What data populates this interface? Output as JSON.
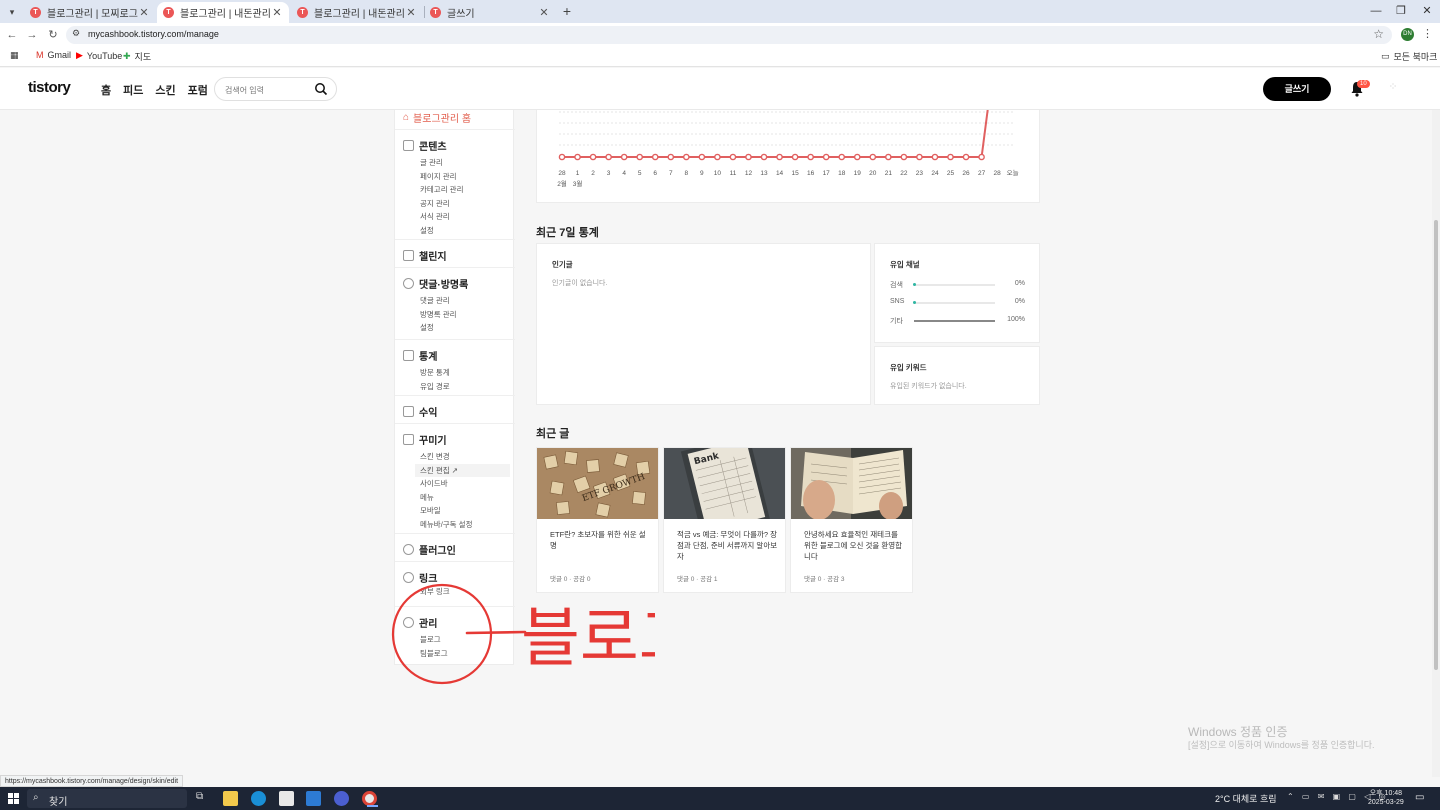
{
  "browser": {
    "tabs": [
      {
        "title": "블로그관리 | 모찌로그",
        "active": false
      },
      {
        "title": "블로그관리 | 내돈관리일지",
        "active": true
      },
      {
        "title": "블로그관리 | 내돈관리일지",
        "active": false
      },
      {
        "title": "글쓰기",
        "active": false
      }
    ],
    "url": "mycashbook.tistory.com/manage",
    "bookmarks": [
      "Gmail",
      "YouTube",
      "지도"
    ],
    "bookmarks_all": "모든 북마크",
    "profile_initials": "DN",
    "status_url": "https://mycashbook.tistory.com/manage/design/skin/edit"
  },
  "header": {
    "logo": "tistory",
    "nav": [
      "홈",
      "피드",
      "스킨",
      "포럼"
    ],
    "search_placeholder": "검색어 입력",
    "write_button": "글쓰기",
    "notification_count": "10"
  },
  "sidebar": {
    "home": "블로그관리 홈",
    "groups": [
      {
        "title": "콘텐츠",
        "items": [
          "글 관리",
          "페이지 관리",
          "카테고리 관리",
          "공지 관리",
          "서식 관리",
          "설정"
        ]
      },
      {
        "title": "챌린지",
        "items": []
      },
      {
        "title": "댓글·방명록",
        "items": [
          "댓글 관리",
          "방명록 관리",
          "설정"
        ]
      },
      {
        "title": "통계",
        "items": [
          "방문 통계",
          "유입 경로"
        ]
      },
      {
        "title": "수익",
        "items": []
      },
      {
        "title": "꾸미기",
        "items": [
          "스킨 변경",
          "스킨 편집",
          "사이드바",
          "메뉴",
          "모바일",
          "메뉴바/구독 설정"
        ]
      },
      {
        "title": "플러그인",
        "items": []
      },
      {
        "title": "링크",
        "items": [
          "외부 링크"
        ]
      },
      {
        "title": "관리",
        "items": [
          "블로그",
          "팀블로그"
        ]
      }
    ]
  },
  "chart_data": {
    "type": "line",
    "x": [
      "28",
      "1",
      "2",
      "3",
      "4",
      "5",
      "6",
      "7",
      "8",
      "9",
      "10",
      "11",
      "12",
      "13",
      "14",
      "15",
      "16",
      "17",
      "18",
      "19",
      "20",
      "21",
      "22",
      "23",
      "24",
      "25",
      "26",
      "27",
      "28",
      "오늘"
    ],
    "month_labels": [
      "2월",
      "3월"
    ],
    "values": [
      0,
      0,
      0,
      0,
      0,
      0,
      0,
      0,
      0,
      0,
      0,
      0,
      0,
      0,
      0,
      0,
      0,
      0,
      0,
      0,
      0,
      0,
      0,
      0,
      0,
      0,
      0,
      0,
      12
    ],
    "color": "#e06060",
    "grid": true
  },
  "stats7": {
    "title": "최근 7일 통계",
    "popular": {
      "title": "인기글",
      "empty": "인기글이 없습니다."
    },
    "channels": {
      "title": "유입 채널",
      "rows": [
        {
          "name": "검색",
          "value": "0%",
          "fraction": 0
        },
        {
          "name": "SNS",
          "value": "0%",
          "fraction": 0
        },
        {
          "name": "기타",
          "value": "100%",
          "fraction": 1
        }
      ]
    },
    "keywords": {
      "title": "유입 키워드",
      "empty": "유입된 키워드가 없습니다."
    }
  },
  "recent": {
    "title": "최근 글",
    "posts": [
      {
        "title": "ETF란? 초보자를 위한 쉬운 설명",
        "meta": "댓글 0 · 공감 0"
      },
      {
        "title": "적금 vs 예금: 무엇이 다를까? 장점과 단점, 준비 서류까지 알아보자",
        "meta": "댓글 0 · 공감 1"
      },
      {
        "title": "안녕하세요 효율적인 재테크를 위한 블로그에 오신 것을 환영합니다",
        "meta": "댓글 0 · 공감 3"
      }
    ],
    "thumb_texts": {
      "scrabble": "ETF GROWTH",
      "bank": "Bank"
    }
  },
  "annotation": {
    "text": "블로그",
    "color": "#e53935"
  },
  "watermark": {
    "line1": "Windows 정품 인증",
    "line2": "[설정]으로 이동하여 Windows를 정품 인증합니다."
  },
  "taskbar": {
    "search": "찾기",
    "weather": "2°C 대체로 흐림",
    "time": "오후 10:48",
    "date": "2025-03-29"
  }
}
